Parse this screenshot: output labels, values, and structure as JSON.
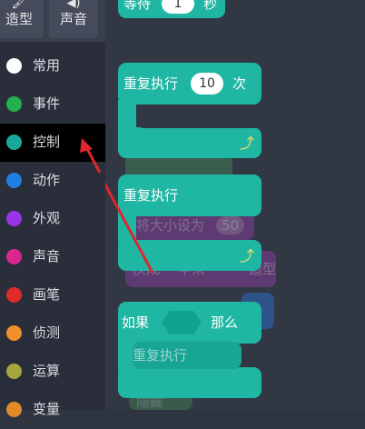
{
  "tabs": [
    {
      "label": "造型",
      "icon": "costume-icon"
    },
    {
      "label": "声音",
      "icon": "speaker-icon"
    }
  ],
  "categories": [
    {
      "label": "常用",
      "color": "#ffffff"
    },
    {
      "label": "事件",
      "color": "#22b14c"
    },
    {
      "label": "控制",
      "color": "#1aa89a"
    },
    {
      "label": "动作",
      "color": "#1e7fe0"
    },
    {
      "label": "外观",
      "color": "#9b33e6"
    },
    {
      "label": "声音",
      "color": "#d8288e"
    },
    {
      "label": "画笔",
      "color": "#e02b2b"
    },
    {
      "label": "侦测",
      "color": "#f0902a"
    },
    {
      "label": "运算",
      "color": "#a5a83d"
    },
    {
      "label": "变量",
      "color": "#e08a2a"
    }
  ],
  "blocks": {
    "wait": {
      "label": "等待",
      "value": "1",
      "unit": "秒"
    },
    "repeat_n": {
      "label": "重复执行",
      "value": "10",
      "unit": "次"
    },
    "forever": {
      "label": "重复执行"
    },
    "if": {
      "label": "如果",
      "then": "那么"
    },
    "if_inner": {
      "label": "重复执行"
    }
  },
  "ghost": {
    "set_size": "将大小设为",
    "size_value": "50",
    "switch": "换成",
    "costume_name": "苹果",
    "costume_suffix": "造型",
    "hide": "隐藏"
  },
  "colors": {
    "control": "#1fb6a3",
    "accent_arrow": "#e0252f"
  }
}
